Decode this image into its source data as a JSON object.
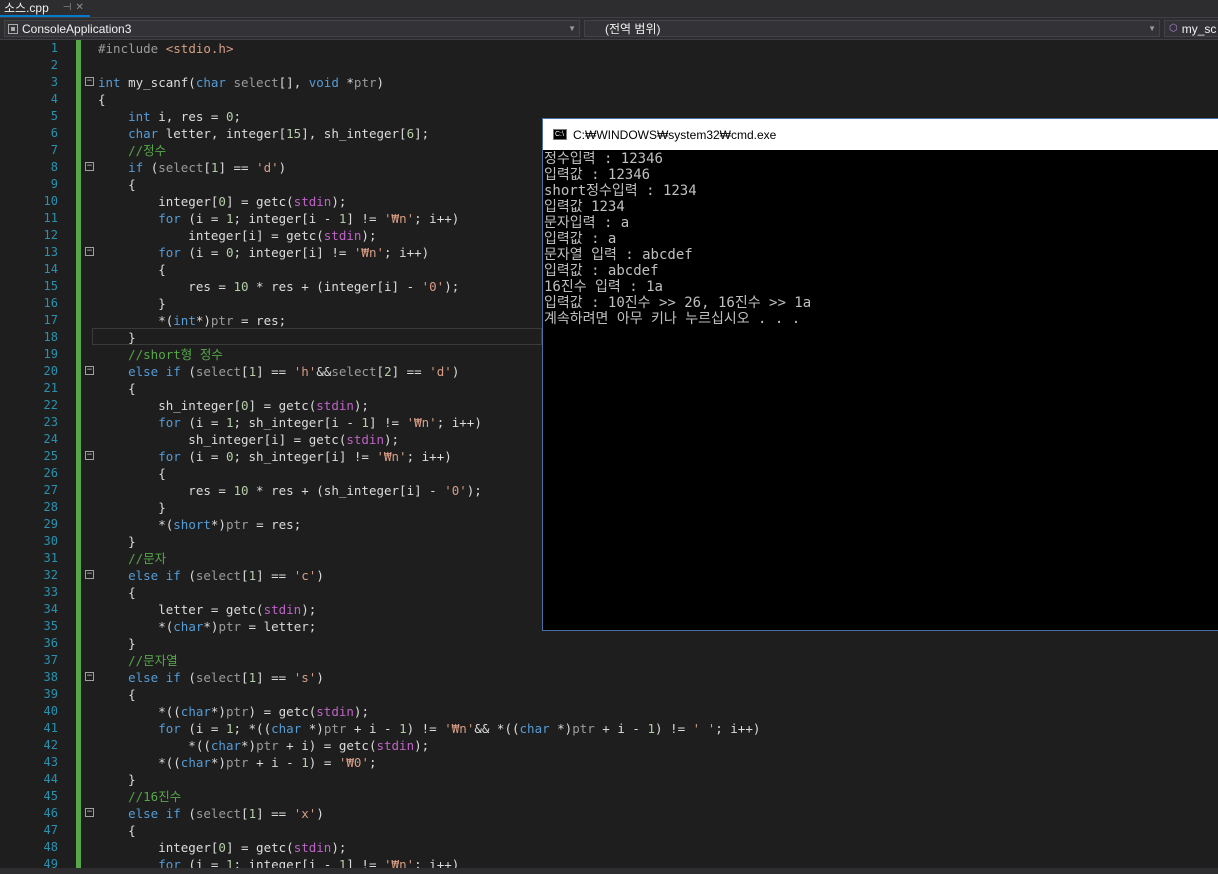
{
  "tab": {
    "filename": "소스.cpp",
    "pin_icon": "pin-icon",
    "close_icon": "close-icon"
  },
  "navbar": {
    "project": "ConsoleApplication3",
    "scope": "(전역 범위)",
    "member": "my_sc"
  },
  "editor": {
    "line_numbers": [
      "1",
      "2",
      "3",
      "4",
      "5",
      "6",
      "7",
      "8",
      "9",
      "10",
      "11",
      "12",
      "13",
      "14",
      "15",
      "16",
      "17",
      "18",
      "19",
      "20",
      "21",
      "22",
      "23",
      "24",
      "25",
      "26",
      "27",
      "28",
      "29",
      "30",
      "31",
      "32",
      "33",
      "34",
      "35",
      "36",
      "37",
      "38",
      "39",
      "40",
      "41",
      "42",
      "43",
      "44",
      "45",
      "46",
      "47",
      "48",
      "49"
    ],
    "lines": [
      "#include <stdio.h>",
      "",
      "int my_scanf(char select[], void *ptr)",
      "{",
      "    int i, res = 0;",
      "    char letter, integer[15], sh_integer[6];",
      "    //정수",
      "    if (select[1] == 'd')",
      "    {",
      "        integer[0] = getc(stdin);",
      "        for (i = 1; integer[i - 1] != '₩n'; i++)",
      "            integer[i] = getc(stdin);",
      "        for (i = 0; integer[i] != '₩n'; i++)",
      "        {",
      "            res = 10 * res + (integer[i] - '0');",
      "        }",
      "        *(int*)ptr = res;",
      "    }",
      "    //short형 정수",
      "    else if (select[1] == 'h'&&select[2] == 'd')",
      "    {",
      "        sh_integer[0] = getc(stdin);",
      "        for (i = 1; sh_integer[i - 1] != '₩n'; i++)",
      "            sh_integer[i] = getc(stdin);",
      "        for (i = 0; sh_integer[i] != '₩n'; i++)",
      "        {",
      "            res = 10 * res + (sh_integer[i] - '0');",
      "        }",
      "        *(short*)ptr = res;",
      "    }",
      "    //문자",
      "    else if (select[1] == 'c')",
      "    {",
      "        letter = getc(stdin);",
      "        *(char*)ptr = letter;",
      "    }",
      "    //문자열",
      "    else if (select[1] == 's')",
      "    {",
      "        *((char*)ptr) = getc(stdin);",
      "        for (i = 1; *((char *)ptr + i - 1) != '₩n'&& *((char *)ptr + i - 1) != ' '; i++)",
      "            *((char*)ptr + i) = getc(stdin);",
      "        *((char*)ptr + i - 1) = '₩0';",
      "    }",
      "    //16진수",
      "    else if (select[1] == 'x')",
      "    {",
      "        integer[0] = getc(stdin);",
      "        for (i = 1; integer[i - 1] != '₩n'; i++)"
    ]
  },
  "console": {
    "title": "C:₩WINDOWS₩system32₩cmd.exe",
    "icon": "cmd-icon",
    "output": [
      "정수입력 : 12346",
      "입력값 : 12346",
      "short정수입력 : 1234",
      "입력값 1234",
      "문자입력 : a",
      "입력값 : a",
      "문자열 입력 : abcdef",
      "입력값 : abcdef",
      "16진수 입력 : 1a",
      "입력값 : 10진수 >> 26, 16진수 >> 1a",
      "계속하려면 아무 키나 누르십시오 . . ."
    ]
  },
  "colors": {
    "background": "#1e1e1e",
    "line_number": "#2b91af",
    "keyword": "#569cd6",
    "comment": "#57a64a",
    "string": "#d69d85",
    "number": "#b5cea8",
    "console_bg": "#000000",
    "console_text": "#c0c0c0"
  }
}
